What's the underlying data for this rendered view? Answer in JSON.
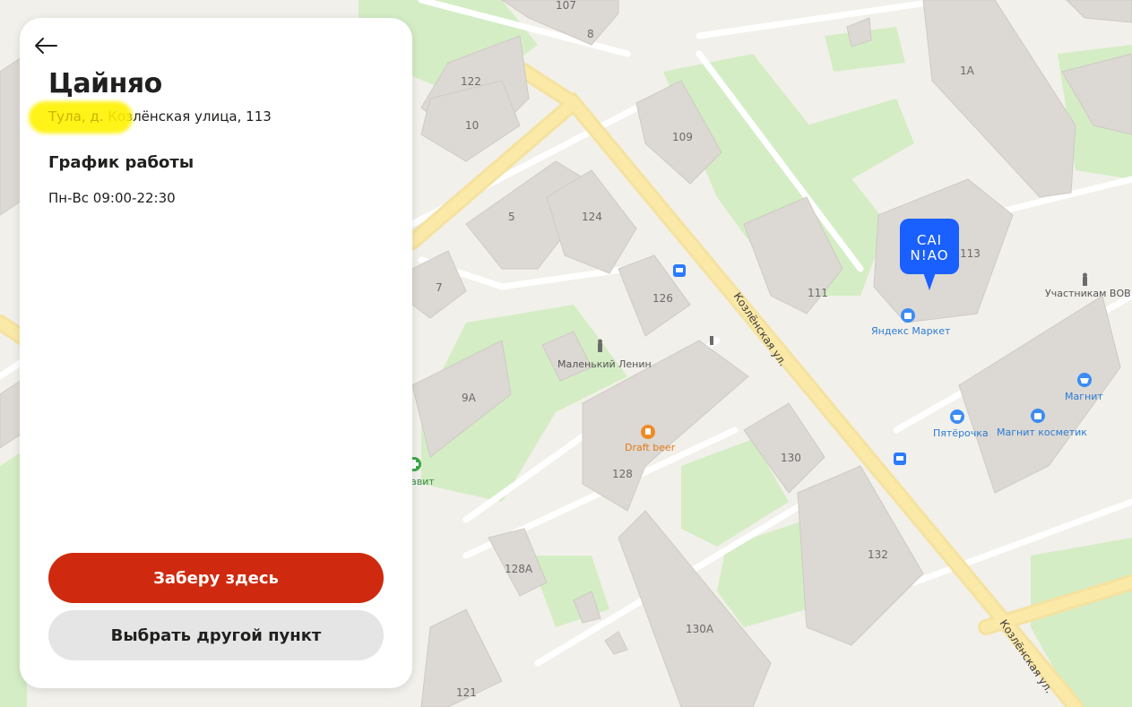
{
  "panel": {
    "title": "Цайняо",
    "address_city": "Тула, д.",
    "address": "Козлёнская улица, 113",
    "schedule_title": "График работы",
    "schedule_text": "Пн-Вс 09:00-22:30",
    "primary_button": "Заберу здесь",
    "secondary_button": "Выбрать другой пункт"
  },
  "map": {
    "street_label": "Козлёнская ул.",
    "building_numbers": {
      "b107": "107",
      "b8": "8",
      "b122": "122",
      "b10": "10",
      "b109": "109",
      "b1a": "1А",
      "b5": "5",
      "b124": "124",
      "b7": "7",
      "b126": "126",
      "b111": "111",
      "b113": "113",
      "b9a": "9А",
      "b128": "128",
      "b130": "130",
      "b128a": "128А",
      "b132": "132",
      "b130a": "130А",
      "b121": "121"
    },
    "poi": {
      "lenin": "Маленький Ленин",
      "draft_beer": "Draft beer",
      "yandex_market": "Яндекс Маркет",
      "magnit": "Магнит",
      "pyaterochka": "Пятёрочка",
      "magnit_cosmetic": "Магнит косметик",
      "vov": "Участникам ВОВ",
      "savit": "савит"
    },
    "marker": {
      "line1": "CAI",
      "line2": "N!AO"
    }
  },
  "colors": {
    "map_bg": "#f2f0ea",
    "park": "#d4edc5",
    "building": "#dcd8d3",
    "road_main": "#fbe79b",
    "primary": "#cf2a0f",
    "marker": "#1a5fff"
  }
}
